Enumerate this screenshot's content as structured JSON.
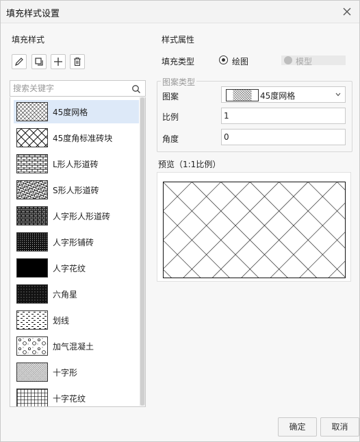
{
  "window": {
    "title": "填充样式设置",
    "close_icon": "close-icon"
  },
  "left": {
    "section_label": "填充样式",
    "toolbar": [
      "edit-icon",
      "copy-icon",
      "add-icon",
      "delete-icon"
    ],
    "search": {
      "placeholder": "搜索关键字",
      "value": ""
    },
    "items": [
      {
        "label": "45度网格",
        "pattern": "diag-grid-dense",
        "selected": true
      },
      {
        "label": "45度角标准砖块",
        "pattern": "herringbone",
        "selected": false
      },
      {
        "label": "L形人形道砖",
        "pattern": "l-brick",
        "selected": false
      },
      {
        "label": "S形人形道砖",
        "pattern": "s-brick",
        "selected": false
      },
      {
        "label": "人字形人形道砖",
        "pattern": "herring-paver",
        "selected": false
      },
      {
        "label": "人字形铺砖",
        "pattern": "dense-dots",
        "selected": false
      },
      {
        "label": "人字花纹",
        "pattern": "solid-black",
        "selected": false
      },
      {
        "label": "六角星",
        "pattern": "star-dots",
        "selected": false
      },
      {
        "label": "划线",
        "pattern": "dashes",
        "selected": false
      },
      {
        "label": "加气混凝土",
        "pattern": "circles",
        "selected": false
      },
      {
        "label": "十字形",
        "pattern": "fine-cross",
        "selected": false
      },
      {
        "label": "十字花纹",
        "pattern": "grid",
        "selected": false
      }
    ]
  },
  "right": {
    "section_label": "样式属性",
    "fill_type_label": "填充类型",
    "fill_type_options": [
      {
        "label": "绘图",
        "checked": true,
        "enabled": true
      },
      {
        "label": "模型",
        "checked": false,
        "enabled": false
      }
    ],
    "pattern_group_legend": "图案类型",
    "pattern_label": "图案",
    "pattern_value": "45度网格",
    "scale_label": "比例",
    "scale_value": "1",
    "angle_label": "角度",
    "angle_value": "0",
    "preview_label": "预览（1:1比例）"
  },
  "footer": {
    "ok": "确定",
    "cancel": "取消"
  }
}
